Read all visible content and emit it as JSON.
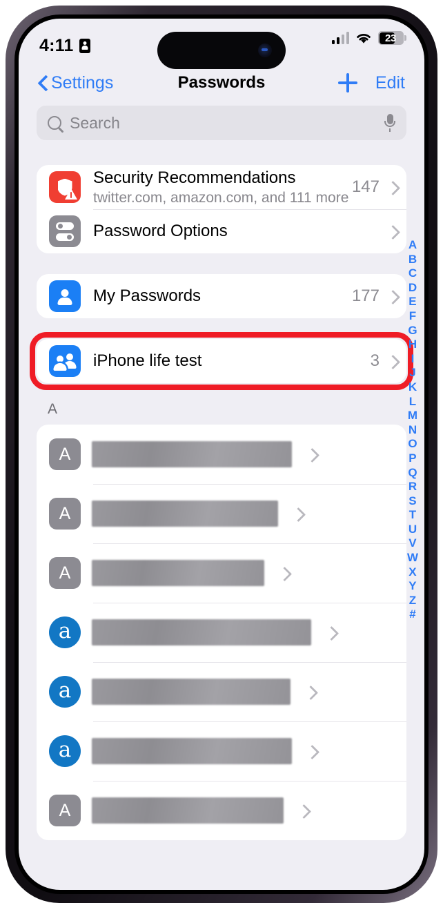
{
  "status_bar": {
    "time": "4:11",
    "screen_time_icon": "person-badge-icon",
    "cellular_icon": "cellular-bars-icon",
    "cellular_bars_active": 2,
    "wifi_icon": "wifi-icon",
    "battery_icon": "battery-icon",
    "battery_level": "23"
  },
  "nav": {
    "back_label": "Settings",
    "back_icon": "chevron-left-icon",
    "title": "Passwords",
    "add_icon": "plus-icon",
    "edit_label": "Edit"
  },
  "search": {
    "placeholder": "Search",
    "value": "",
    "search_icon": "search-icon",
    "mic_icon": "microphone-icon"
  },
  "groups": [
    {
      "rows": [
        {
          "name": "security-recommendations",
          "icon": "shield-warning-icon",
          "label": "Security Recommendations",
          "subtitle": "twitter.com, amazon.com, and 111 more",
          "count": "147"
        },
        {
          "name": "password-options",
          "icon": "toggles-icon",
          "label": "Password Options",
          "subtitle": "",
          "count": ""
        }
      ]
    },
    {
      "rows": [
        {
          "name": "my-passwords",
          "icon": "person-icon",
          "label": "My Passwords",
          "subtitle": "",
          "count": "177"
        }
      ]
    }
  ],
  "highlighted_row": {
    "name": "iphone-life-test",
    "icon": "group-people-icon",
    "label": "iPhone life test",
    "count": "3",
    "highlight_color": "#ef1c26"
  },
  "section": {
    "header": "A",
    "entries": [
      {
        "avatar_type": "letter",
        "avatar": "A",
        "redacted_width": 290
      },
      {
        "avatar_type": "letter",
        "avatar": "A",
        "redacted_width": 270
      },
      {
        "avatar_type": "letter",
        "avatar": "A",
        "redacted_width": 250
      },
      {
        "avatar_type": "circle-a",
        "avatar": "a",
        "redacted_width": 318
      },
      {
        "avatar_type": "circle-a",
        "avatar": "a",
        "redacted_width": 288
      },
      {
        "avatar_type": "circle-a",
        "avatar": "a",
        "redacted_width": 290
      },
      {
        "avatar_type": "letter",
        "avatar": "A",
        "redacted_width": 278
      }
    ]
  },
  "alphabet_index": [
    "A",
    "B",
    "C",
    "D",
    "E",
    "F",
    "G",
    "H",
    "I",
    "J",
    "K",
    "L",
    "M",
    "N",
    "O",
    "P",
    "Q",
    "R",
    "S",
    "T",
    "U",
    "V",
    "W",
    "X",
    "Y",
    "Z",
    "#"
  ],
  "colors": {
    "accent_blue": "#2f7cf6",
    "icon_blue": "#1b7ff5",
    "danger_red": "#f03e32",
    "highlight_red": "#ef1c26",
    "page_background": "#efeef4",
    "card_background": "#ffffff"
  }
}
